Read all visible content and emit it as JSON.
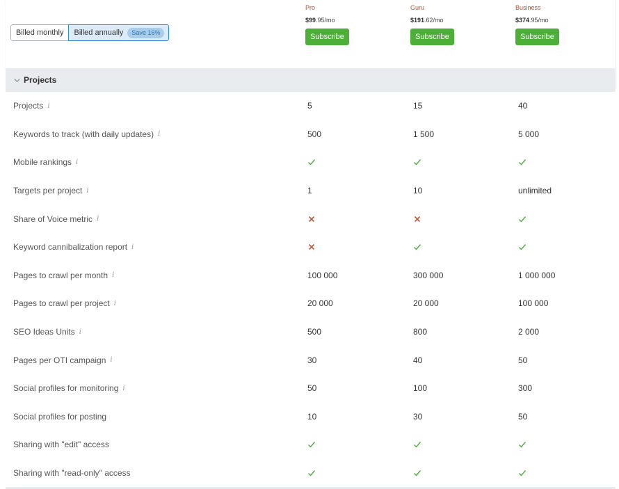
{
  "billing": {
    "monthly_label": "Billed monthly",
    "annual_label": "Billed annually",
    "save_badge": "Save 16%",
    "selected": "annual"
  },
  "plans": [
    {
      "name": "Pro",
      "price_main": "$99",
      "price_cents": ".95",
      "price_period": "/mo",
      "button": "Subscribe"
    },
    {
      "name": "Guru",
      "price_main": "$191",
      "price_cents": ".62",
      "price_period": "/mo",
      "button": "Subscribe"
    },
    {
      "name": "Business",
      "price_main": "$374",
      "price_cents": ".95",
      "price_period": "/mo",
      "button": "Subscribe"
    }
  ],
  "section": {
    "title": "Projects",
    "expanded": true,
    "icon": "chevron-down-icon"
  },
  "colors": {
    "plan_name": "#b4512a",
    "subscribe": "#4caf38",
    "check": "#4caf38",
    "cross": "#c0583a",
    "toggle_active": "#2f8fd1"
  },
  "info_glyph": "i",
  "rows": [
    {
      "feature": "Projects",
      "info": true,
      "values": [
        "5",
        "15",
        "40"
      ]
    },
    {
      "feature": "Keywords to track (with daily updates)",
      "info": true,
      "values": [
        "500",
        "1 500",
        "5 000"
      ]
    },
    {
      "feature": "Mobile rankings",
      "info": true,
      "values": [
        "check",
        "check",
        "check"
      ]
    },
    {
      "feature": "Targets per project",
      "info": true,
      "values": [
        "1",
        "10",
        "unlimited"
      ]
    },
    {
      "feature": "Share of Voice metric",
      "info": true,
      "values": [
        "cross",
        "cross",
        "check"
      ]
    },
    {
      "feature": "Keyword cannibalization report",
      "info": true,
      "values": [
        "cross",
        "check",
        "check"
      ]
    },
    {
      "feature": "Pages to crawl per month",
      "info": true,
      "values": [
        "100 000",
        "300 000",
        "1 000 000"
      ]
    },
    {
      "feature": "Pages to crawl per project",
      "info": true,
      "values": [
        "20 000",
        "20 000",
        "100 000"
      ]
    },
    {
      "feature": "SEO Ideas Units",
      "info": true,
      "values": [
        "500",
        "800",
        "2 000"
      ]
    },
    {
      "feature": "Pages per OTI campaign",
      "info": true,
      "values": [
        "30",
        "40",
        "50"
      ]
    },
    {
      "feature": "Social profiles for monitoring",
      "info": true,
      "values": [
        "50",
        "100",
        "300"
      ]
    },
    {
      "feature": "Social profiles for posting",
      "info": false,
      "values": [
        "10",
        "30",
        "50"
      ]
    },
    {
      "feature": "Sharing with \"edit\" access",
      "info": false,
      "values": [
        "check",
        "check",
        "check"
      ]
    },
    {
      "feature": "Sharing with \"read-only\" access",
      "info": false,
      "values": [
        "check",
        "check",
        "check"
      ]
    }
  ]
}
